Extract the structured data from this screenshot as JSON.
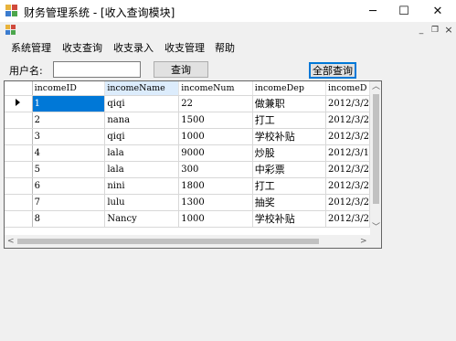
{
  "window": {
    "title": "财务管理系统 - [收入查询模块]",
    "minimize_glyph": "─",
    "maximize_glyph": "☐",
    "close_glyph": "✕"
  },
  "mdi": {
    "minimize_glyph": "_",
    "restore_glyph": "❐",
    "close_glyph": "×"
  },
  "menu": {
    "items": [
      {
        "label": "系统管理"
      },
      {
        "label": "收支查询"
      },
      {
        "label": "收支录入"
      },
      {
        "label": "收支管理"
      },
      {
        "label": "帮助"
      }
    ]
  },
  "search": {
    "user_label": "用户名:",
    "user_value": "",
    "query_button": "查询",
    "query_all_button": "全部查询"
  },
  "grid": {
    "columns": [
      "incomeID",
      "incomeName",
      "incomeNum",
      "incomeDep",
      "incomeD"
    ],
    "rows": [
      [
        "1",
        "qiqi",
        "22",
        "做兼职",
        "2012/3/2"
      ],
      [
        "2",
        "nana",
        "1500",
        "打工",
        "2012/3/2"
      ],
      [
        "3",
        "qiqi",
        "1000",
        "学校补贴",
        "2012/3/2"
      ],
      [
        "4",
        "lala",
        "9000",
        "炒股",
        "2012/3/1"
      ],
      [
        "5",
        "lala",
        "300",
        "中彩票",
        "2012/3/2"
      ],
      [
        "6",
        "nini",
        "1800",
        "打工",
        "2012/3/2"
      ],
      [
        "7",
        "lulu",
        "1300",
        "抽奖",
        "2012/3/2"
      ],
      [
        "8",
        "Nancy",
        "1000",
        "学校补贴",
        "2012/3/2"
      ]
    ]
  },
  "colors": {
    "selection": "#0078d7",
    "header_selected": "#dcecfc",
    "accent_border": "#0078d7"
  },
  "icons": {
    "app": "app-icon",
    "mdi": "mdi-child-icon",
    "current_row": "current-row-arrow-icon",
    "scroll_up": "scroll-up-icon",
    "scroll_down": "scroll-down-icon",
    "scroll_left": "scroll-left-icon",
    "scroll_right": "scroll-right-icon"
  }
}
